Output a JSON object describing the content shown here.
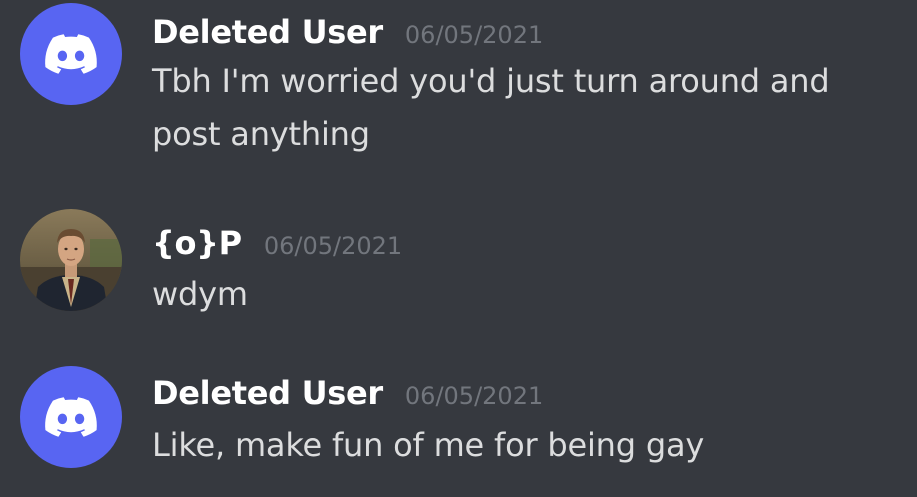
{
  "messages": [
    {
      "username": "Deleted User",
      "timestamp": "06/05/2021",
      "avatar": "discord-logo-icon",
      "lines": [
        "Tbh I'm worried you'd just turn around and",
        "post anything"
      ]
    },
    {
      "username": "{o}P",
      "timestamp": "06/05/2021",
      "avatar": "user-photo",
      "lines": [
        "wdym"
      ]
    },
    {
      "username": "Deleted User",
      "timestamp": "06/05/2021",
      "avatar": "discord-logo-icon",
      "lines": [
        "Like, make fun of me for being gay"
      ]
    }
  ],
  "colors": {
    "background": "#36393f",
    "username": "#ffffff",
    "timestamp": "#72767d",
    "message_text": "#dcddde",
    "discord_blurple": "#5865f2"
  }
}
